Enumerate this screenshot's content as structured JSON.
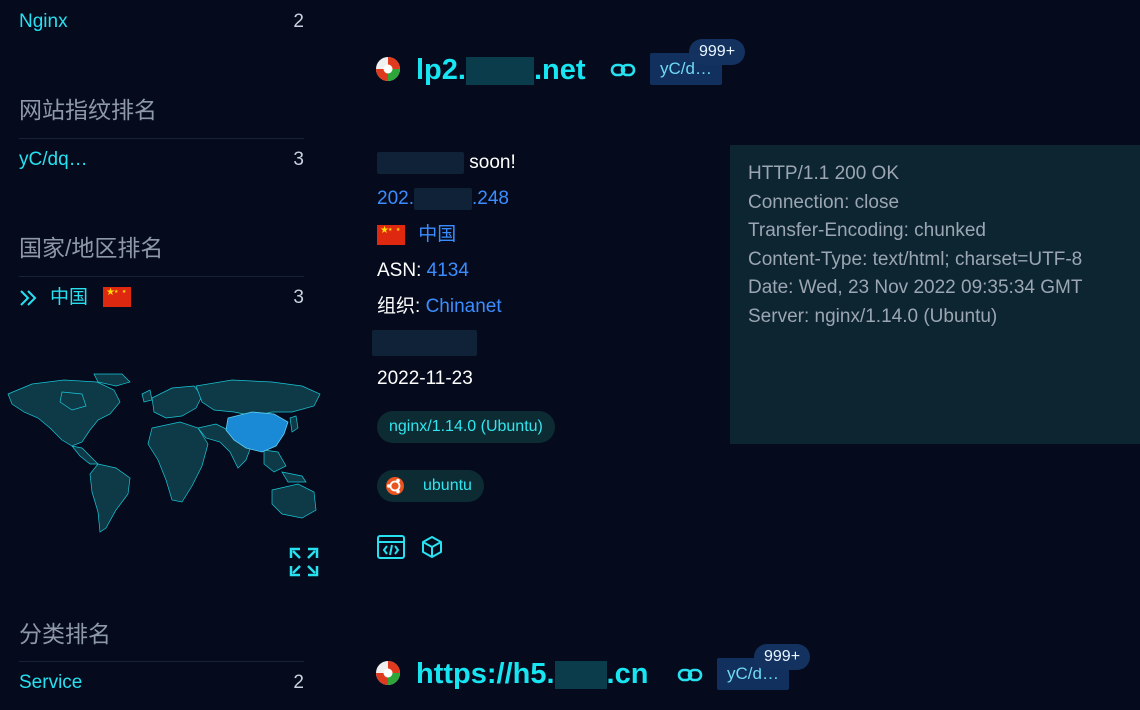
{
  "sidebar": {
    "top_item": {
      "label": "Nginx",
      "count": "2"
    },
    "fingerprint_section": {
      "title": "网站指纹排名",
      "items": [
        {
          "label": "yC/dq…",
          "count": "3"
        }
      ]
    },
    "country_section": {
      "title": "国家/地区排名",
      "items": [
        {
          "label": "中国",
          "count": "3",
          "flag": "cn-flag"
        }
      ]
    },
    "category_section": {
      "title": "分类排名",
      "items": [
        {
          "label": "Service",
          "count": "2"
        }
      ]
    },
    "map": {
      "highlight_color": "#1a8ad6",
      "land_color": "#0e3a48",
      "border_color": "#1ac6d6"
    }
  },
  "results": [
    {
      "host_prefix": "lp2.",
      "host_suffix": ".net",
      "fingerprint_tag": "yC/d…",
      "badge": "999+",
      "title_suffix": "soon!",
      "ip_prefix": "202.",
      "ip_suffix": ".248",
      "country": "中国",
      "asn_label": "ASN:",
      "asn": "4134",
      "org_label": "组织:",
      "org": "Chinanet",
      "date": "2022-11-23",
      "tags": [
        "nginx/1.14.0 (Ubuntu)",
        "ubuntu"
      ],
      "response": [
        "HTTP/1.1 200 OK",
        "Connection: close",
        "Transfer-Encoding: chunked",
        "Content-Type: text/html; charset=UTF-8",
        "Date: Wed, 23 Nov 2022 09:35:34 GMT",
        "Server: nginx/1.14.0 (Ubuntu)"
      ]
    },
    {
      "host_prefix": "https://h5.",
      "host_suffix": ".cn",
      "fingerprint_tag": "yC/d…",
      "badge": "999+"
    }
  ],
  "colors": {
    "accent": "#17e6f2",
    "link": "#3b8dff",
    "background": "#050b1c"
  }
}
